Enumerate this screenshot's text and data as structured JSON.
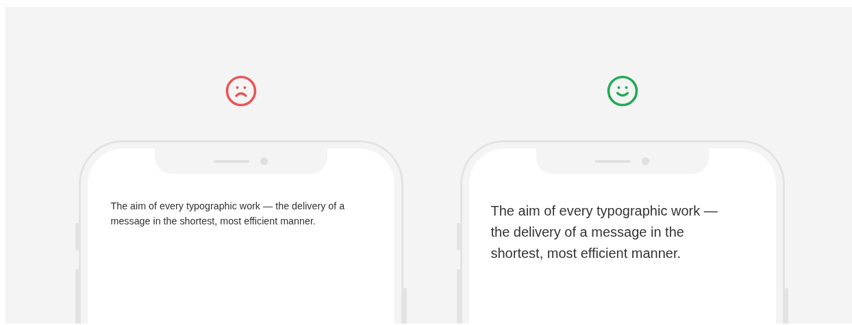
{
  "panels": [
    {
      "kind": "bad",
      "text": "The aim of every typographic work — the delivery of a message in the shortest, most efficient manner."
    },
    {
      "kind": "good",
      "text": "The aim of every typographic work — the delivery of a message in the shortest, most efficient manner."
    }
  ]
}
